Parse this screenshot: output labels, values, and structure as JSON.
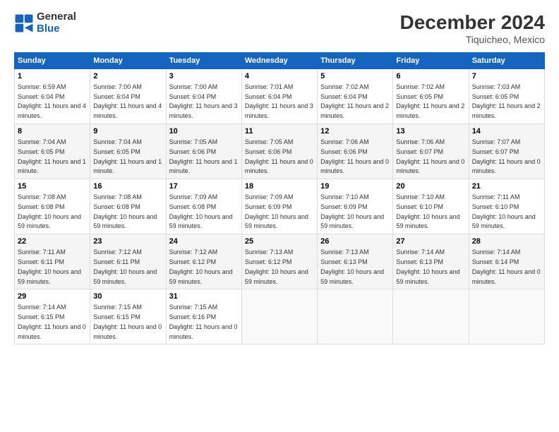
{
  "logo": {
    "line1": "General",
    "line2": "Blue"
  },
  "title": "December 2024",
  "subtitle": "Tiquicheo, Mexico",
  "days_header": [
    "Sunday",
    "Monday",
    "Tuesday",
    "Wednesday",
    "Thursday",
    "Friday",
    "Saturday"
  ],
  "weeks": [
    [
      {
        "num": "1",
        "rise": "6:59 AM",
        "set": "6:04 PM",
        "daylight": "11 hours and 4 minutes."
      },
      {
        "num": "2",
        "rise": "7:00 AM",
        "set": "6:04 PM",
        "daylight": "11 hours and 4 minutes."
      },
      {
        "num": "3",
        "rise": "7:00 AM",
        "set": "6:04 PM",
        "daylight": "11 hours and 3 minutes."
      },
      {
        "num": "4",
        "rise": "7:01 AM",
        "set": "6:04 PM",
        "daylight": "11 hours and 3 minutes."
      },
      {
        "num": "5",
        "rise": "7:02 AM",
        "set": "6:04 PM",
        "daylight": "11 hours and 2 minutes."
      },
      {
        "num": "6",
        "rise": "7:02 AM",
        "set": "6:05 PM",
        "daylight": "11 hours and 2 minutes."
      },
      {
        "num": "7",
        "rise": "7:03 AM",
        "set": "6:05 PM",
        "daylight": "11 hours and 2 minutes."
      }
    ],
    [
      {
        "num": "8",
        "rise": "7:04 AM",
        "set": "6:05 PM",
        "daylight": "11 hours and 1 minute."
      },
      {
        "num": "9",
        "rise": "7:04 AM",
        "set": "6:05 PM",
        "daylight": "11 hours and 1 minute."
      },
      {
        "num": "10",
        "rise": "7:05 AM",
        "set": "6:06 PM",
        "daylight": "11 hours and 1 minute."
      },
      {
        "num": "11",
        "rise": "7:05 AM",
        "set": "6:06 PM",
        "daylight": "11 hours and 0 minutes."
      },
      {
        "num": "12",
        "rise": "7:06 AM",
        "set": "6:06 PM",
        "daylight": "11 hours and 0 minutes."
      },
      {
        "num": "13",
        "rise": "7:06 AM",
        "set": "6:07 PM",
        "daylight": "11 hours and 0 minutes."
      },
      {
        "num": "14",
        "rise": "7:07 AM",
        "set": "6:07 PM",
        "daylight": "11 hours and 0 minutes."
      }
    ],
    [
      {
        "num": "15",
        "rise": "7:08 AM",
        "set": "6:08 PM",
        "daylight": "10 hours and 59 minutes."
      },
      {
        "num": "16",
        "rise": "7:08 AM",
        "set": "6:08 PM",
        "daylight": "10 hours and 59 minutes."
      },
      {
        "num": "17",
        "rise": "7:09 AM",
        "set": "6:08 PM",
        "daylight": "10 hours and 59 minutes."
      },
      {
        "num": "18",
        "rise": "7:09 AM",
        "set": "6:09 PM",
        "daylight": "10 hours and 59 minutes."
      },
      {
        "num": "19",
        "rise": "7:10 AM",
        "set": "6:09 PM",
        "daylight": "10 hours and 59 minutes."
      },
      {
        "num": "20",
        "rise": "7:10 AM",
        "set": "6:10 PM",
        "daylight": "10 hours and 59 minutes."
      },
      {
        "num": "21",
        "rise": "7:11 AM",
        "set": "6:10 PM",
        "daylight": "10 hours and 59 minutes."
      }
    ],
    [
      {
        "num": "22",
        "rise": "7:11 AM",
        "set": "6:11 PM",
        "daylight": "10 hours and 59 minutes."
      },
      {
        "num": "23",
        "rise": "7:12 AM",
        "set": "6:11 PM",
        "daylight": "10 hours and 59 minutes."
      },
      {
        "num": "24",
        "rise": "7:12 AM",
        "set": "6:12 PM",
        "daylight": "10 hours and 59 minutes."
      },
      {
        "num": "25",
        "rise": "7:13 AM",
        "set": "6:12 PM",
        "daylight": "10 hours and 59 minutes."
      },
      {
        "num": "26",
        "rise": "7:13 AM",
        "set": "6:13 PM",
        "daylight": "10 hours and 59 minutes."
      },
      {
        "num": "27",
        "rise": "7:14 AM",
        "set": "6:13 PM",
        "daylight": "10 hours and 59 minutes."
      },
      {
        "num": "28",
        "rise": "7:14 AM",
        "set": "6:14 PM",
        "daylight": "11 hours and 0 minutes."
      }
    ],
    [
      {
        "num": "29",
        "rise": "7:14 AM",
        "set": "6:15 PM",
        "daylight": "11 hours and 0 minutes."
      },
      {
        "num": "30",
        "rise": "7:15 AM",
        "set": "6:15 PM",
        "daylight": "11 hours and 0 minutes."
      },
      {
        "num": "31",
        "rise": "7:15 AM",
        "set": "6:16 PM",
        "daylight": "11 hours and 0 minutes."
      },
      null,
      null,
      null,
      null
    ]
  ],
  "labels": {
    "sunrise": "Sunrise:",
    "sunset": "Sunset:",
    "daylight": "Daylight:"
  }
}
